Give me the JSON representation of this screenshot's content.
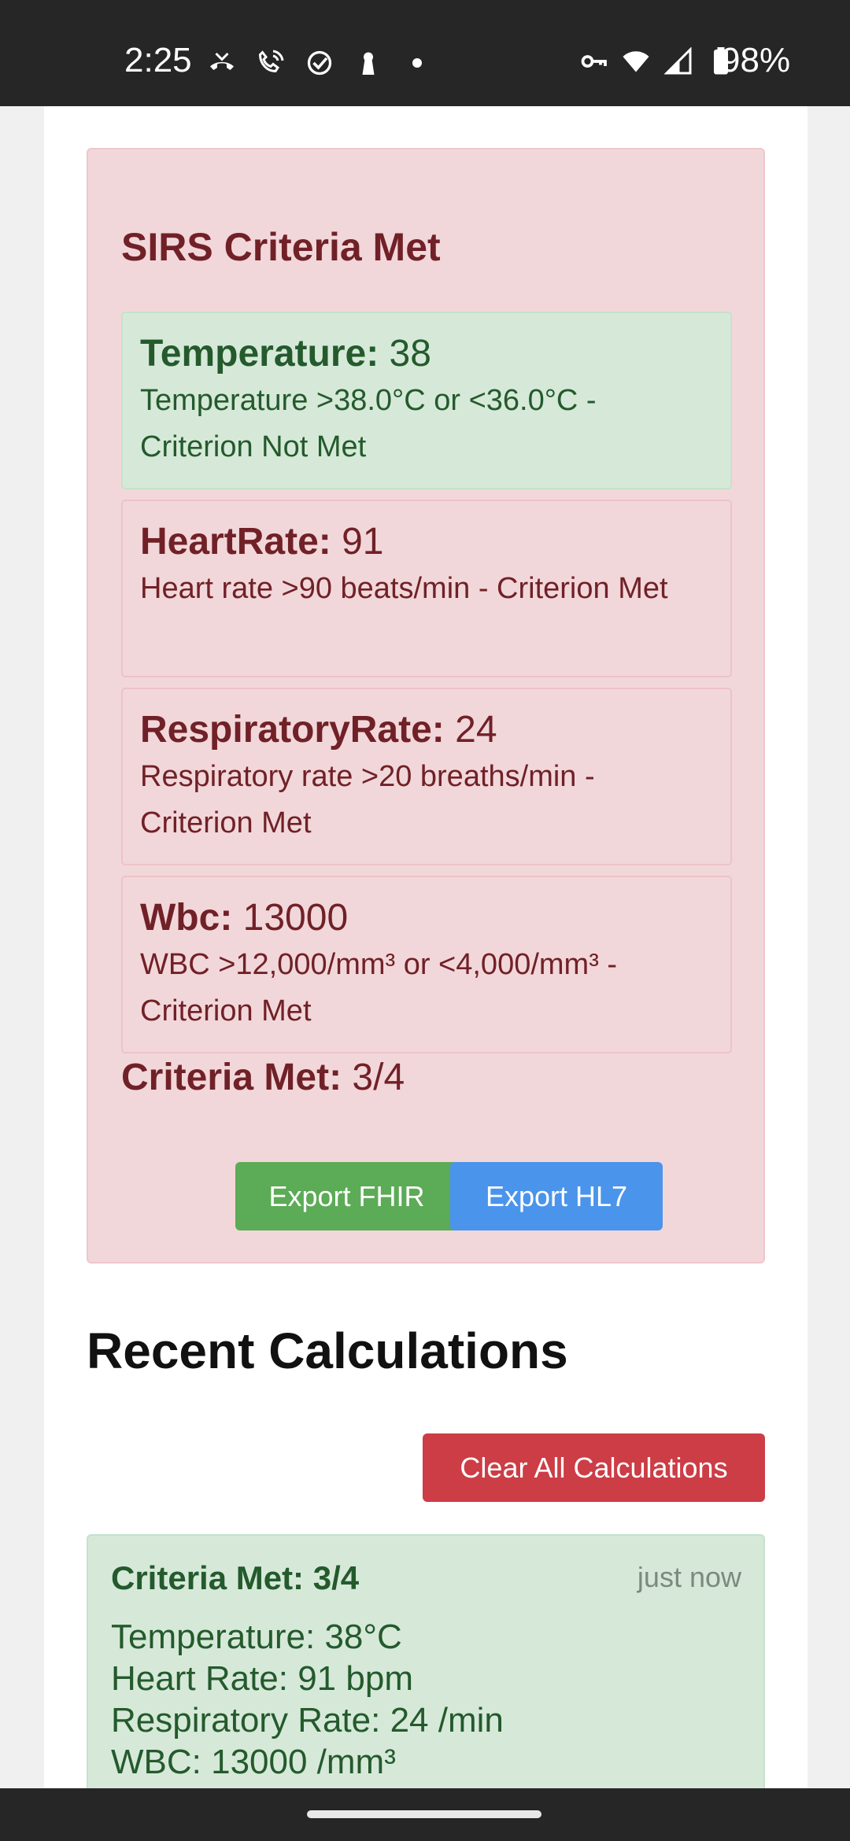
{
  "status_bar": {
    "time": "2:25",
    "battery": "98%",
    "left_icons": [
      "missed-call-icon",
      "wifi-call-icon",
      "check-circle-icon",
      "keyhole-icon",
      "dot-icon"
    ],
    "right_icons": [
      "vpn-key-icon",
      "wifi-icon",
      "signal-icon",
      "battery-icon"
    ]
  },
  "result": {
    "title": "SIRS Criteria Met",
    "criteria": [
      {
        "name": "Temperature:",
        "value": "38",
        "description": "Temperature >38.0°C or <36.0°C - Criterion Not Met",
        "met": false
      },
      {
        "name": "HeartRate:",
        "value": "91",
        "description": "Heart rate >90 beats/min - Criterion Met",
        "met": true
      },
      {
        "name": "RespiratoryRate:",
        "value": "24",
        "description": "Respiratory rate >20 breaths/min - Criterion Met",
        "met": true
      },
      {
        "name": "Wbc:",
        "value": "13000",
        "description": "WBC >12,000/mm³ or <4,000/mm³ - Criterion Met",
        "met": true
      }
    ],
    "total_label": "Criteria Met:",
    "total_value": "3/4",
    "export_fhir": "Export FHIR",
    "export_hl7": "Export HL7"
  },
  "recent": {
    "title": "Recent Calculations",
    "clear_label": "Clear All Calculations",
    "items": [
      {
        "title": "Criteria Met: 3/4",
        "time": "just now",
        "lines": [
          "Temperature: 38°C",
          "Heart Rate: 91 bpm",
          "Respiratory Rate: 24 /min",
          "WBC: 13000 /mm³"
        ]
      }
    ]
  },
  "colors": {
    "alert_bg": "#f2d7da",
    "alert_text": "#702127",
    "ok_bg": "#d6e9d9",
    "ok_text": "#245a2c",
    "fhir_button": "#5cab56",
    "hl7_button": "#4a94ec",
    "clear_button": "#cc3d46"
  }
}
